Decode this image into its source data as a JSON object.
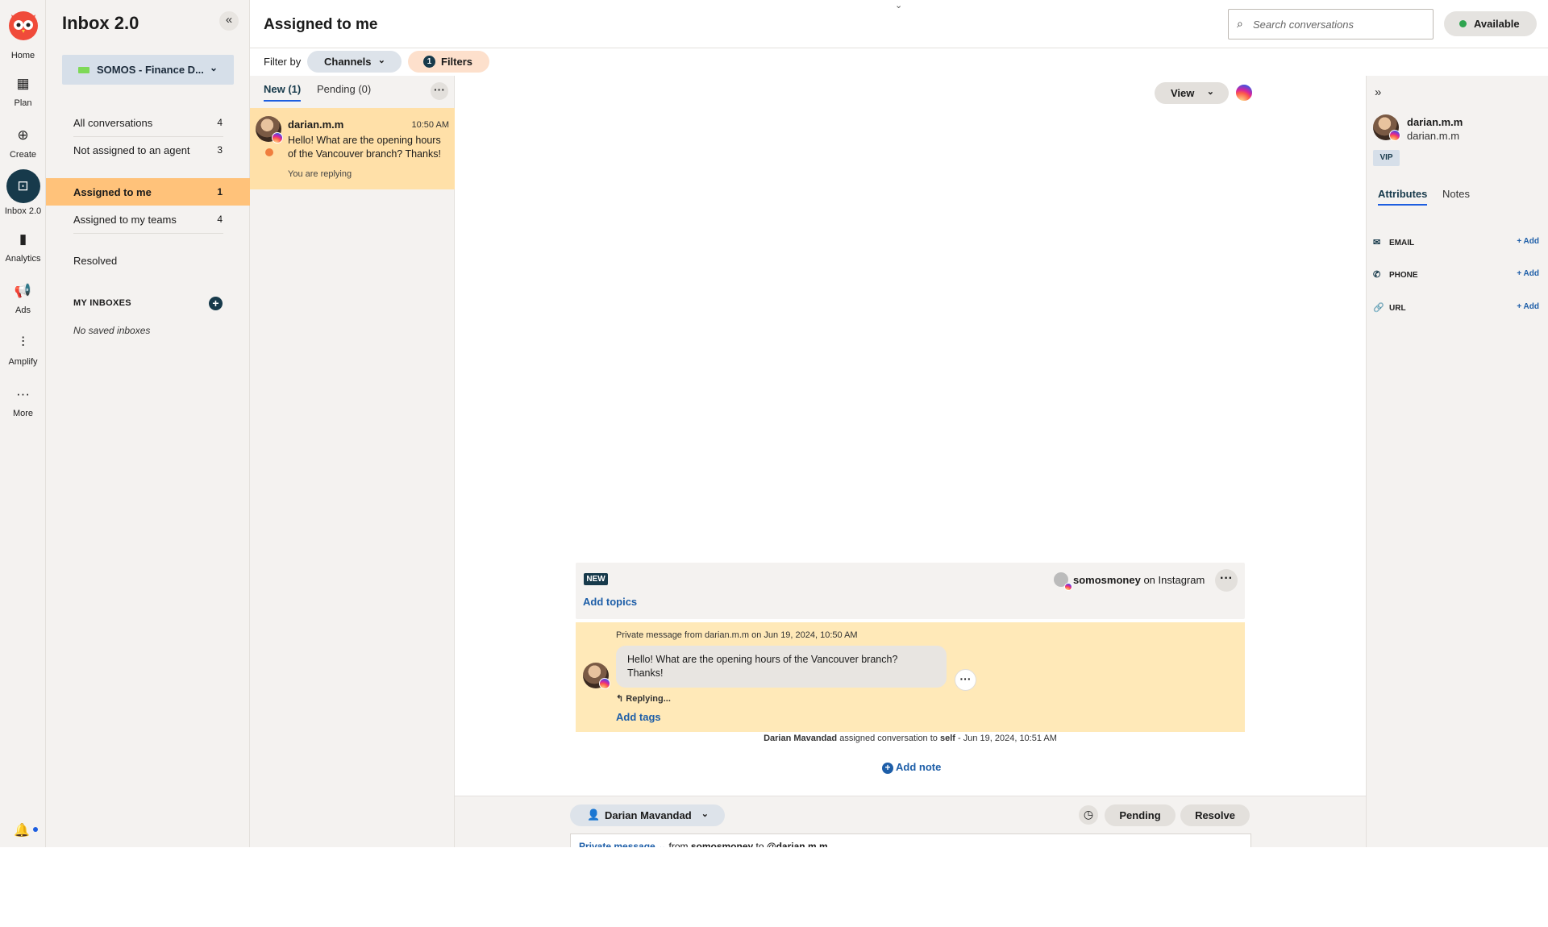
{
  "rail": {
    "items": [
      {
        "label": "Home",
        "icon": "owl-logo-icon"
      },
      {
        "label": "Plan",
        "icon": "calendar-icon"
      },
      {
        "label": "Create",
        "icon": "plus-circle-icon"
      },
      {
        "label": "Inbox 2.0",
        "icon": "inbox-icon"
      },
      {
        "label": "Analytics",
        "icon": "bar-chart-icon"
      },
      {
        "label": "Ads",
        "icon": "megaphone-icon"
      },
      {
        "label": "Amplify",
        "icon": "amplify-icon"
      },
      {
        "label": "More",
        "icon": "more-dots-icon"
      }
    ],
    "active": "Inbox 2.0"
  },
  "sidebar": {
    "title": "Inbox 2.0",
    "org_select": "SOMOS - Finance D...",
    "nav": [
      {
        "label": "All conversations",
        "count": "4"
      },
      {
        "label": "Not assigned to an agent",
        "count": "3"
      },
      {
        "label": "Assigned to me",
        "count": "1"
      },
      {
        "label": "Assigned to my teams",
        "count": "4"
      },
      {
        "label": "Resolved",
        "count": ""
      }
    ],
    "my_inboxes_title": "MY INBOXES",
    "no_saved": "No saved inboxes"
  },
  "header": {
    "title": "Assigned to me",
    "search_placeholder": "Search conversations",
    "status": "Available"
  },
  "filterbar": {
    "filter_by": "Filter by",
    "channels": "Channels",
    "filters_count": "1",
    "filters": "Filters"
  },
  "list": {
    "tab_new": "New (1)",
    "tab_pending": "Pending (0)",
    "conversation": {
      "name": "darian.m.m",
      "time": "10:50 AM",
      "text": "Hello! What are the opening hours of the Vancouver branch? Thanks!",
      "status": "You are replying"
    }
  },
  "chat": {
    "view_label": "View",
    "card": {
      "badge": "NEW",
      "add_topics": "Add topics",
      "account": "somosmoney",
      "account_suffix": "on Instagram"
    },
    "message": {
      "meta": "Private message from darian.m.m on Jun 19, 2024, 10:50 AM",
      "text": "Hello! What are the opening hours of the Vancouver branch? Thanks!",
      "replying": "Replying...",
      "add_tags": "Add tags"
    },
    "assign_log": {
      "agent": "Darian Mavandad",
      "middle": "assigned conversation to",
      "target": "self",
      "time": "- Jun 19, 2024, 10:51 AM"
    },
    "add_note": "Add note",
    "bottom": {
      "agent": "Darian Mavandad",
      "pending": "Pending",
      "resolve": "Resolve"
    },
    "composer": {
      "type": "Private message",
      "from_label": "from",
      "from": "somosmoney",
      "to_label": "to",
      "to": "@darian.m.m"
    }
  },
  "rpanel": {
    "name": "darian.m.m",
    "handle": "darian.m.m",
    "vip": "VIP",
    "tab_attributes": "Attributes",
    "tab_notes": "Notes",
    "attributes": [
      {
        "label": "EMAIL",
        "add": "+ Add",
        "icon": "mail-icon"
      },
      {
        "label": "PHONE",
        "add": "+ Add",
        "icon": "phone-icon"
      },
      {
        "label": "URL",
        "add": "+ Add",
        "icon": "link-icon"
      }
    ]
  }
}
